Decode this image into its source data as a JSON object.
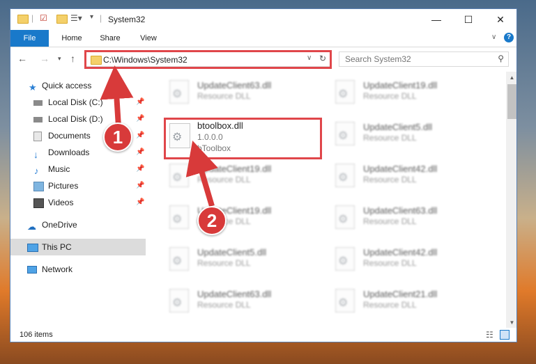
{
  "window": {
    "title": "System32"
  },
  "ribbon": {
    "tabs": [
      "File",
      "Home",
      "Share",
      "View"
    ]
  },
  "navbar": {
    "address": "C:\\Windows\\System32",
    "search_placeholder": "Search System32"
  },
  "sidebar": {
    "items": [
      {
        "label": "Quick access",
        "icon": "star-icon",
        "pinned": false
      },
      {
        "label": "Local Disk (C:)",
        "icon": "drive-icon",
        "pinned": true
      },
      {
        "label": "Local Disk (D:)",
        "icon": "drive-icon",
        "pinned": true
      },
      {
        "label": "Documents",
        "icon": "documents-icon",
        "pinned": true
      },
      {
        "label": "Downloads",
        "icon": "download-icon",
        "pinned": true
      },
      {
        "label": "Music",
        "icon": "music-icon",
        "pinned": true
      },
      {
        "label": "Pictures",
        "icon": "pictures-icon",
        "pinned": true
      },
      {
        "label": "Videos",
        "icon": "videos-icon",
        "pinned": true
      },
      {
        "label": "OneDrive",
        "icon": "cloud-icon",
        "pinned": false
      },
      {
        "label": "This PC",
        "icon": "computer-icon",
        "pinned": false,
        "selected": true
      },
      {
        "label": "Network",
        "icon": "network-icon",
        "pinned": false
      }
    ]
  },
  "files": {
    "left": [
      {
        "name": "UpdateClient63.dll",
        "desc": "Resource DLL"
      },
      {
        "name": "btoolbox.dll",
        "version": "1.0.0.0",
        "desc": "bToolbox"
      },
      {
        "name": "UpdateClient19.dll",
        "desc": "Resource DLL"
      },
      {
        "name": "UpdateClient19.dll",
        "desc": "Resource DLL"
      },
      {
        "name": "UpdateClient5.dll",
        "desc": "Resource DLL"
      },
      {
        "name": "UpdateClient63.dll",
        "desc": "Resource DLL"
      }
    ],
    "right": [
      {
        "name": "UpdateClient19.dll",
        "desc": "Resource DLL"
      },
      {
        "name": "UpdateClient5.dll",
        "desc": "Resource DLL"
      },
      {
        "name": "UpdateClient42.dll",
        "desc": "Resource DLL"
      },
      {
        "name": "UpdateClient63.dll",
        "desc": "Resource DLL"
      },
      {
        "name": "UpdateClient42.dll",
        "desc": "Resource DLL"
      },
      {
        "name": "UpdateClient21.dll",
        "desc": "Resource DLL"
      }
    ]
  },
  "status": {
    "count": "106 items"
  },
  "callouts": [
    "1",
    "2"
  ],
  "colors": {
    "accent": "#1979ca",
    "highlight": "#e0464a",
    "selected": "#dcdcdc"
  }
}
